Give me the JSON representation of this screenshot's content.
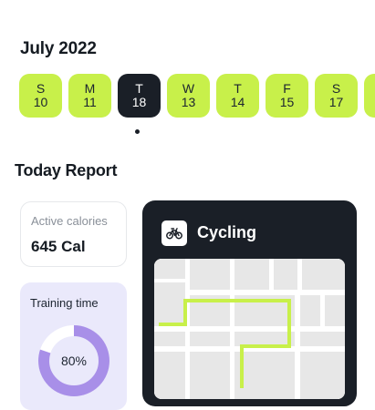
{
  "calendar": {
    "month_title": "July 2022",
    "days": [
      {
        "weekday": "S",
        "date": "10"
      },
      {
        "weekday": "M",
        "date": "11"
      },
      {
        "weekday": "T",
        "date": "18"
      },
      {
        "weekday": "W",
        "date": "13"
      },
      {
        "weekday": "T",
        "date": "14"
      },
      {
        "weekday": "F",
        "date": "15"
      },
      {
        "weekday": "S",
        "date": "17"
      }
    ],
    "selected_index": 2
  },
  "report": {
    "title": "Today Report",
    "active_calories": {
      "label": "Active calories",
      "value": "645 Cal"
    },
    "training_time": {
      "label": "Training time",
      "percent_text": "80%",
      "progress": 0.8
    },
    "cycling": {
      "title": "Cycling",
      "icon": "bicycle-icon"
    }
  },
  "colors": {
    "accent": "#c8f04a",
    "dark": "#1a1f27",
    "progress": "#a88fe8",
    "progress_track": "#ffffff",
    "training_bg": "#eae9fb",
    "route": "#c8f04a"
  }
}
